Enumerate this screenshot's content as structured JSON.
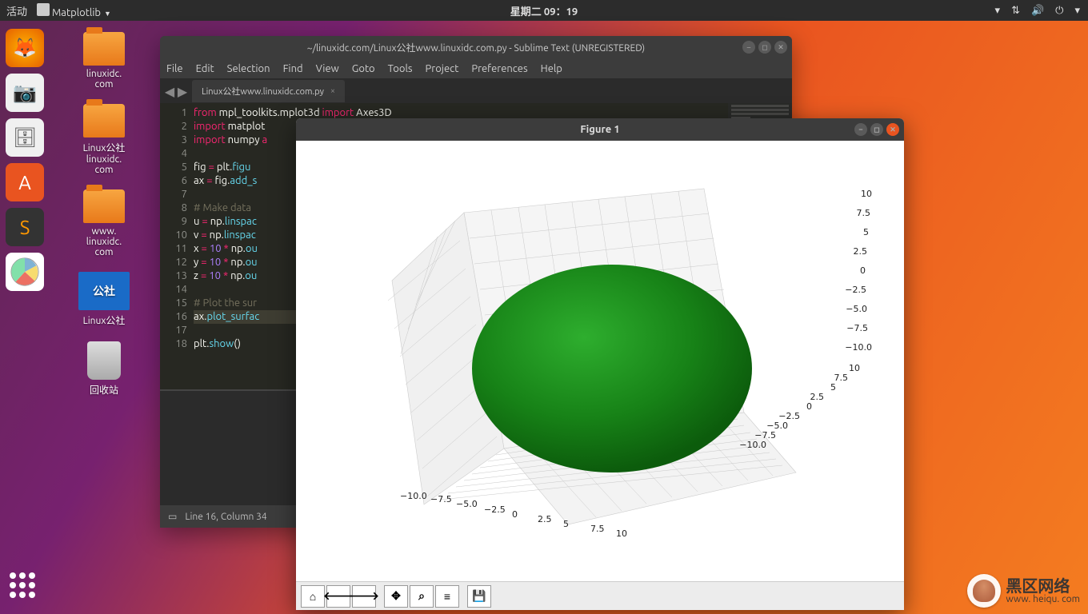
{
  "topbar": {
    "activities": "活动",
    "app": "Matplotlib",
    "clock": "星期二 09：19"
  },
  "desktop": {
    "icons": [
      {
        "label": "linuxidc.\ncom"
      },
      {
        "label": "Linux公社\nlinuxidc.\ncom"
      },
      {
        "label": "www.\nlinuxidc.\ncom"
      },
      {
        "label": "Linux公社"
      },
      {
        "label": "回收站"
      }
    ]
  },
  "sublime": {
    "title": "~/linuxidc.com/Linux公社www.linuxidc.com.py - Sublime Text (UNREGISTERED)",
    "menu": [
      "File",
      "Edit",
      "Selection",
      "Find",
      "View",
      "Goto",
      "Tools",
      "Project",
      "Preferences",
      "Help"
    ],
    "tab": "Linux公社www.linuxidc.com.py",
    "status_icon": "▭",
    "status": "Line 16, Column 34",
    "lines": [
      "1",
      "2",
      "3",
      "4",
      "5",
      "6",
      "7",
      "8",
      "9",
      "10",
      "11",
      "12",
      "13",
      "14",
      "15",
      "16",
      "17",
      "18"
    ],
    "code": {
      "l1": {
        "a": "from",
        "b": " mpl_toolkits.mplot3d ",
        "c": "import",
        "d": " Axes3D"
      },
      "l2": {
        "a": "import",
        "b": " matplot"
      },
      "l3": {
        "a": "import",
        "b": " numpy ",
        "c": "a"
      },
      "l5": {
        "a": "fig ",
        "b": "=",
        "c": " plt.",
        "d": "figu"
      },
      "l6": {
        "a": "ax ",
        "b": "=",
        "c": " fig.",
        "d": "add_s"
      },
      "l8": "# Make data",
      "l9": {
        "a": "u ",
        "b": "=",
        "c": " np.",
        "d": "linspac"
      },
      "l10": {
        "a": "v ",
        "b": "=",
        "c": " np.",
        "d": "linspac"
      },
      "l11": {
        "a": "x ",
        "b": "=",
        "c": " ",
        "d": "10",
        "e": " ",
        "f": "*",
        "g": " np.",
        "h": "ou"
      },
      "l12": {
        "a": "y ",
        "b": "=",
        "c": " ",
        "d": "10",
        "e": " ",
        "f": "*",
        "g": " np.",
        "h": "ou"
      },
      "l13": {
        "a": "z ",
        "b": "=",
        "c": " ",
        "d": "10",
        "e": " ",
        "f": "*",
        "g": " np.",
        "h": "ou"
      },
      "l15": "# Plot the sur",
      "l16": {
        "a": "ax.",
        "b": "plot_surfac"
      },
      "l18": {
        "a": "plt.",
        "b": "show",
        "c": "()"
      }
    }
  },
  "figure": {
    "title": "Figure 1",
    "toolbar": {
      "home": "⌂",
      "back": "🡐",
      "fwd": "🡒",
      "pan": "✥",
      "zoom": "⌕",
      "cfg": "≡",
      "save": "💾"
    }
  },
  "chart_data": {
    "type": "surface3d",
    "title": "",
    "x_ticks": [
      -10.0,
      -7.5,
      -5.0,
      -2.5,
      0.0,
      2.5,
      5.0,
      7.5,
      10.0
    ],
    "y_ticks": [
      -10.0,
      -7.5,
      -5.0,
      -2.5,
      0.0,
      2.5,
      5.0,
      7.5,
      10.0
    ],
    "z_ticks": [
      -10.0,
      -7.5,
      -5.0,
      -2.5,
      0.0,
      2.5,
      5.0,
      7.5,
      10.0
    ],
    "xlim": [
      -10,
      10
    ],
    "ylim": [
      -10,
      10
    ],
    "zlim": [
      -10,
      10
    ],
    "surface": {
      "shape": "sphere",
      "radius": 10,
      "center": [
        0,
        0,
        0
      ],
      "color": "#1a8b1a"
    }
  },
  "watermark": {
    "text": "黑区网络",
    "url": "www. heiqu. com"
  }
}
